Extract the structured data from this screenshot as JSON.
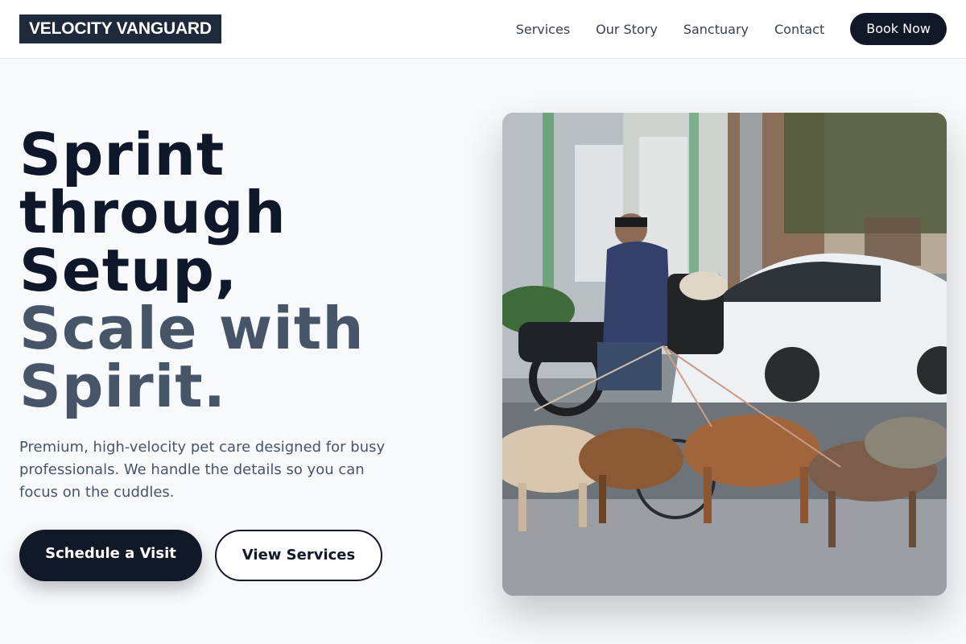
{
  "brand": {
    "name": "VELOCITY VANGUARD"
  },
  "nav": {
    "links": [
      "Services",
      "Our Story",
      "Sanctuary",
      "Contact"
    ],
    "cta_label": "Book Now"
  },
  "hero": {
    "title_dark": [
      "Sprint",
      "through",
      "Setup,"
    ],
    "title_accent": [
      "Scale with",
      "Spirit."
    ],
    "subtitle": "Premium, high-velocity pet care designed for busy professionals. We handle the details so you can focus on the cuddles.",
    "primary_label": "Schedule a Visit",
    "secondary_label": "View Services",
    "image_icon": "photo-dog-walker-on-bicycle-with-pack-of-dogs"
  },
  "colors": {
    "brand_dark": "#111827",
    "logo_bg": "#1e293b",
    "title_accent": "#475569",
    "page_bg": "#f8f9fa"
  }
}
